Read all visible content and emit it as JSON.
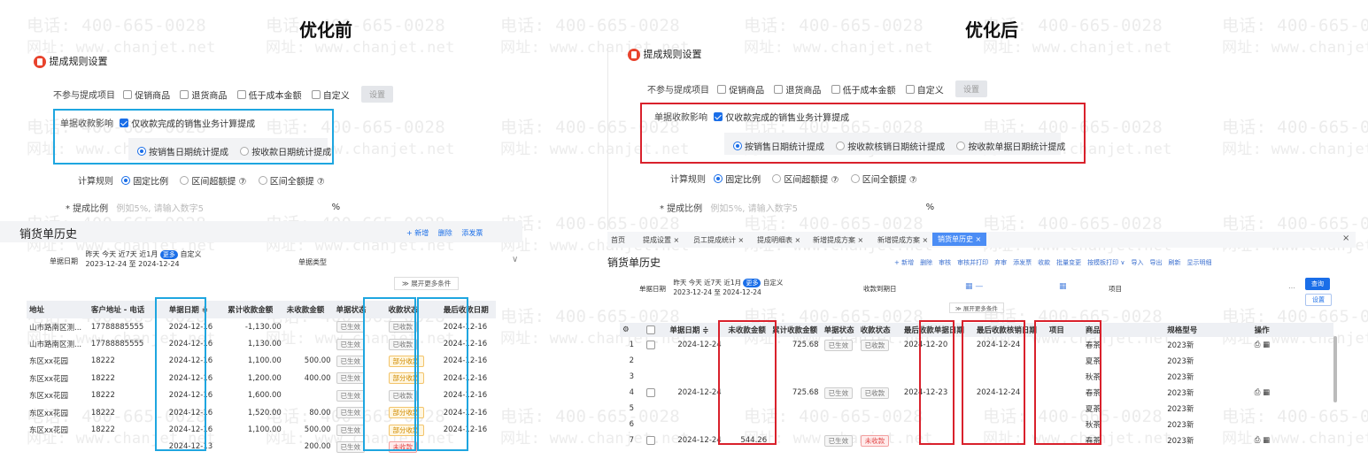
{
  "watermark": {
    "phone": "电话: 400-665-0028",
    "url": "网址: www.chanjet.net"
  },
  "left": {
    "title": "优化前",
    "header": "提成规则设置",
    "exclude_label": "不参与提成项目",
    "exclude_opts": [
      "促销商品",
      "退货商品",
      "低于成本金额",
      "自定义"
    ],
    "set_btn": "设置",
    "impact_label": "单据收款影响",
    "impact_check": "仅收款完成的销售业务计算提成",
    "radio_opts": [
      "按销售日期统计提成",
      "按收款日期统计提成"
    ],
    "calc_label": "计算规则",
    "calc_opts": [
      "固定比例",
      "区间超额提 ⑦",
      "区间全额提 ⑦"
    ],
    "ratio_label": "* 提成比例",
    "ratio_placeholder": "例如5%, 请输入数字5",
    "ratio_unit": "%",
    "history_title": "销货单历史",
    "toolbar": [
      "+ 新增",
      "删除",
      "添发票"
    ],
    "date_label": "单据日期",
    "date_opts": "昨天  今天  近7天  近1月",
    "more": "更多",
    "custom": "自定义",
    "date_range": "2023-12-24 至 2024-12-24",
    "doc_type": "单据类型",
    "expand": "≫ 展开更多条件",
    "columns": [
      "地址",
      "客户地址 - 电话",
      "单据日期 ≑",
      "累计收款金额",
      "未收款金额",
      "单据状态",
      "收款状态",
      "最后收款日期"
    ],
    "rows": [
      [
        "山市路南区测...",
        "17788885555",
        "2024-12-16",
        "-1,130.00",
        "",
        "已生效",
        "已收款",
        "2024-12-16"
      ],
      [
        "山市路南区测...",
        "17788885555",
        "2024-12-16",
        "1,130.00",
        "",
        "已生效",
        "已收款",
        "2024-12-16"
      ],
      [
        "东区xx花园",
        "18222",
        "2024-12-16",
        "1,100.00",
        "500.00",
        "已生效",
        "部分收款",
        "2024-12-16"
      ],
      [
        "东区xx花园",
        "18222",
        "2024-12-16",
        "1,200.00",
        "400.00",
        "已生效",
        "部分收款",
        "2024-12-16"
      ],
      [
        "东区xx花园",
        "18222",
        "2024-12-16",
        "1,600.00",
        "",
        "已生效",
        "已收款",
        "2024-12-16"
      ],
      [
        "东区xx花园",
        "18222",
        "2024-12-16",
        "1,520.00",
        "80.00",
        "已生效",
        "部分收款",
        "2024-12-16"
      ],
      [
        "东区xx花园",
        "18222",
        "2024-12-16",
        "1,100.00",
        "500.00",
        "已生效",
        "部分收款",
        "2024-12-16"
      ],
      [
        "",
        "",
        "2024-12-13",
        "",
        "200.00",
        "已生效",
        "未收款",
        ""
      ]
    ]
  },
  "right": {
    "title": "优化后",
    "header": "提成规则设置",
    "exclude_label": "不参与提成项目",
    "exclude_opts": [
      "促销商品",
      "退货商品",
      "低于成本金额",
      "自定义"
    ],
    "set_btn": "设置",
    "impact_label": "单据收款影响",
    "impact_check": "仅收款完成的销售业务计算提成",
    "radio_opts": [
      "按销售日期统计提成",
      "按收款核销日期统计提成",
      "按收款单据日期统计提成"
    ],
    "calc_label": "计算规则",
    "calc_opts": [
      "固定比例",
      "区间超额提 ⑦",
      "区间全额提 ⑦"
    ],
    "ratio_label": "* 提成比例",
    "ratio_placeholder": "例如5%, 请输入数字5",
    "ratio_unit": "%",
    "tabs": [
      "首页",
      "提成设置 ×",
      "员工提成统计 ×",
      "提成明细表 ×",
      "新增提成方案 ×",
      "新增提成方案 ×",
      "销货单历史 ×"
    ],
    "history_title": "销货单历史",
    "toolbar": [
      "+ 新增",
      "删除",
      "审核",
      "审核并打印",
      "弃审",
      "添发票",
      "收款",
      "批量变更",
      "按模板打印 ∨",
      "导入",
      "导出",
      "刷新",
      "显示明细"
    ],
    "date_label": "单据日期",
    "date_opts": "昨天  今天  近7天  近1月",
    "more": "更多",
    "custom": "自定义",
    "date_range": "2023-12-24 至 2024-12-24",
    "recv_label": "收款到期日",
    "project": "项目",
    "query": "查询",
    "settings": "设置",
    "expand": "≫ 展开更多条件",
    "columns": [
      "单据日期 ≑",
      "未收款金额",
      "累计收款金额",
      "单据状态",
      "收款状态",
      "最后收款单据日期",
      "最后收款核销日期",
      "项目",
      "商品",
      "规格型号",
      "操作"
    ],
    "rows": [
      [
        "1",
        "2024-12-24",
        "",
        "725.68",
        "已生效",
        "已收款",
        "2024-12-20",
        "2024-12-24",
        "",
        "春茶",
        "2023新"
      ],
      [
        "2",
        "",
        "",
        "",
        "",
        "",
        "",
        "",
        "",
        "夏茶",
        "2023新"
      ],
      [
        "3",
        "",
        "",
        "",
        "",
        "",
        "",
        "",
        "",
        "秋茶",
        "2023新"
      ],
      [
        "4",
        "2024-12-24",
        "",
        "725.68",
        "已生效",
        "已收款",
        "2024-12-23",
        "2024-12-24",
        "",
        "春茶",
        "2023新"
      ],
      [
        "5",
        "",
        "",
        "",
        "",
        "",
        "",
        "",
        "",
        "夏茶",
        "2023新"
      ],
      [
        "6",
        "",
        "",
        "",
        "",
        "",
        "",
        "",
        "",
        "秋茶",
        "2023新"
      ],
      [
        "7",
        "2024-12-24",
        "544.26",
        "",
        "已生效",
        "未收款",
        "",
        "",
        "",
        "春茶",
        "2023新"
      ]
    ]
  }
}
